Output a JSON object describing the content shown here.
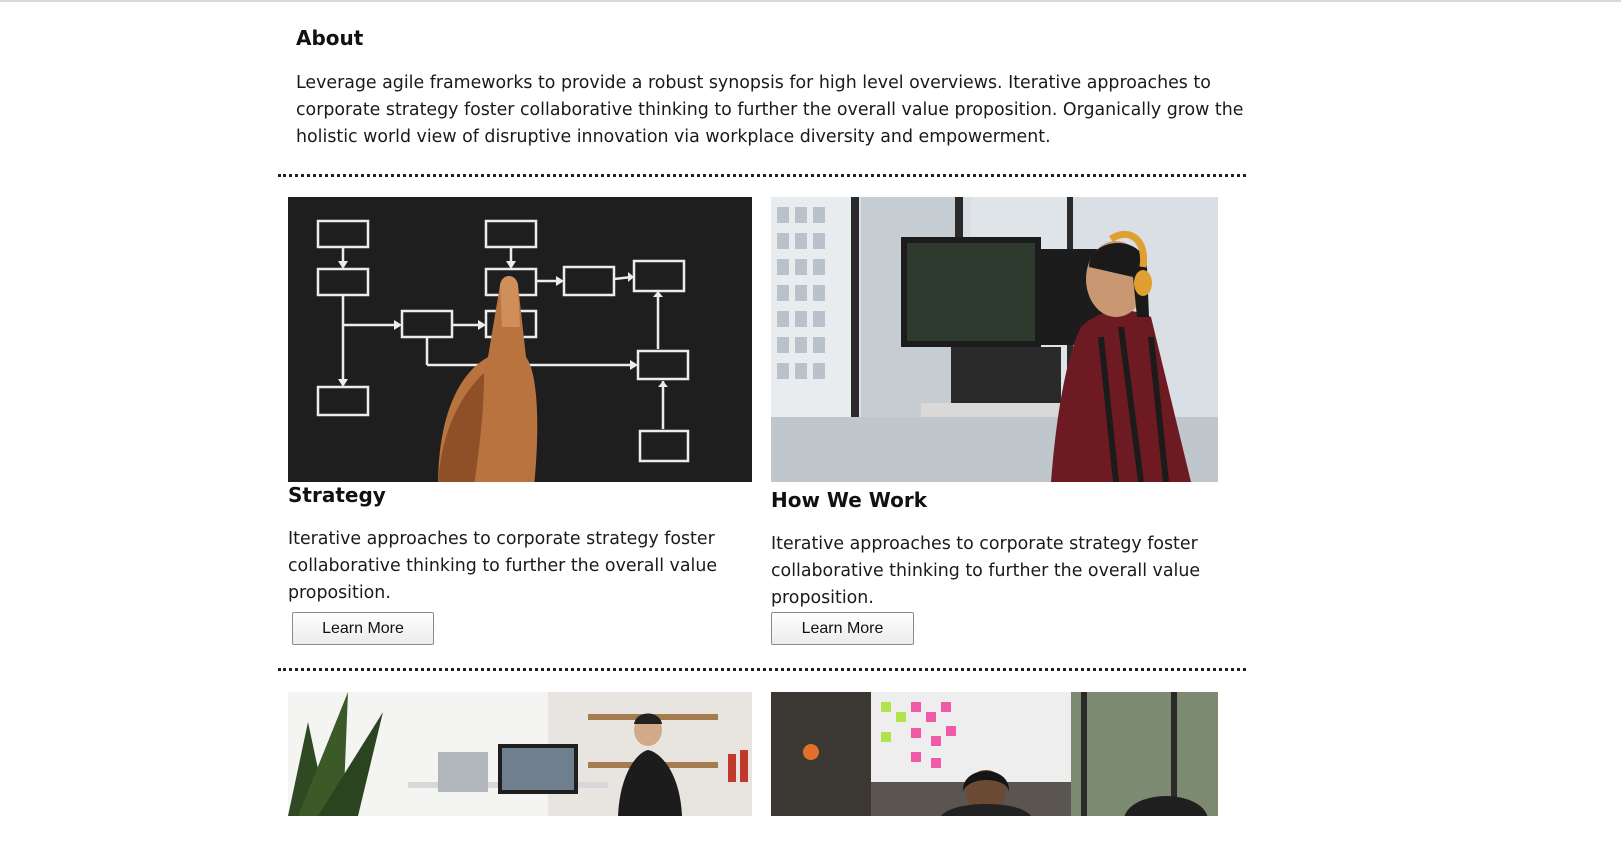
{
  "about": {
    "title": "About",
    "text": "Leverage agile frameworks to provide a robust synopsis for high level overviews. Iterative approaches to corporate strategy foster collaborative thinking to further the overall value proposition. Organically grow the holistic world view of disruptive innovation via workplace diversity and empowerment."
  },
  "cards": [
    {
      "title": "Strategy",
      "text": "Iterative approaches to corporate strategy foster collaborative thinking to further the overall value proposition.",
      "button_label": "Learn More",
      "image": "flowchart-on-chalkboard-photo"
    },
    {
      "title": "How We Work",
      "text": "Iterative approaches to corporate strategy foster collaborative thinking to further the overall value proposition.",
      "button_label": "Learn More",
      "image": "developer-at-monitors-photo"
    },
    {
      "image": "office-desk-photo"
    },
    {
      "image": "meeting-room-photo"
    }
  ],
  "colors": {
    "text": "#111111",
    "divider": "#222222",
    "button_border": "#8a8a8a"
  }
}
